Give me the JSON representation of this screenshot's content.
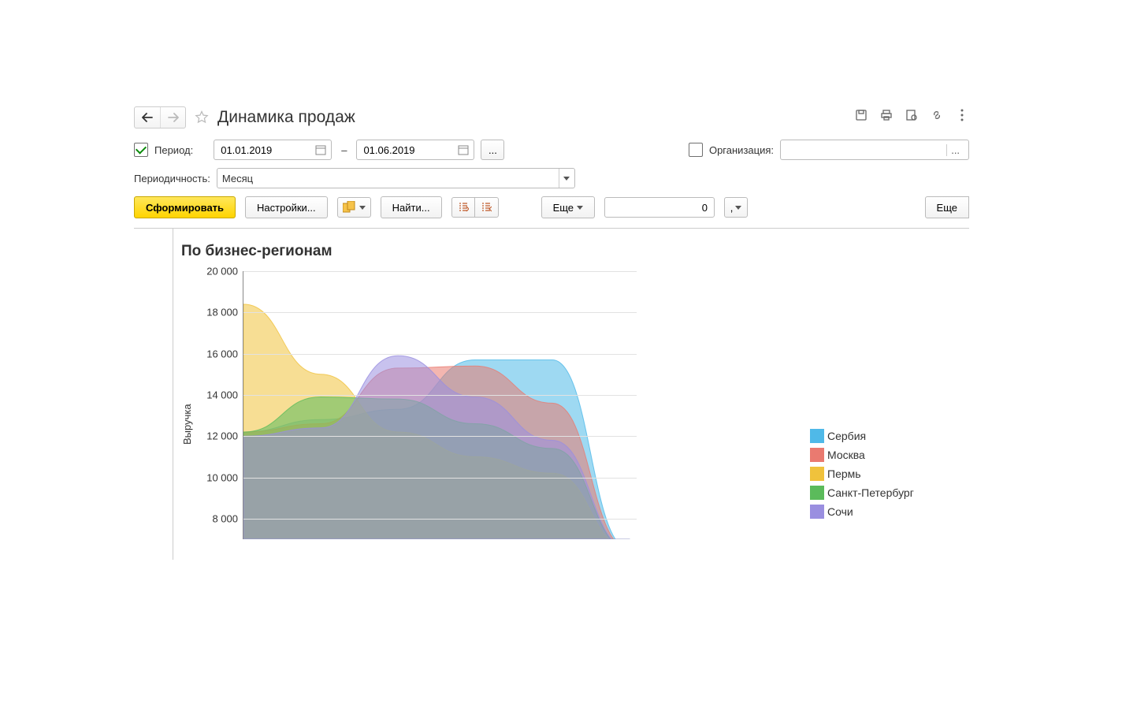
{
  "header": {
    "title": "Динамика продаж"
  },
  "period": {
    "label": "Период:",
    "from": "01.01.2019",
    "to": "01.06.2019",
    "dash": "–",
    "ellipsis": "...",
    "checked": true
  },
  "organization": {
    "label": "Организация:",
    "value": "",
    "ellipsis": "...",
    "checked": false
  },
  "periodicity": {
    "label": "Периодичность:",
    "value": "Месяц"
  },
  "toolbar": {
    "generate": "Сформировать",
    "settings": "Настройки...",
    "find": "Найти...",
    "more1": "Еще",
    "more2": "Еще",
    "num_value": "0",
    "decimal": ","
  },
  "chart": {
    "title": "По бизнес-регионам",
    "ylabel": "Выручка"
  },
  "legend": [
    {
      "name": "Сербия",
      "color": "#4fb9e8"
    },
    {
      "name": "Москва",
      "color": "#ea7a70"
    },
    {
      "name": "Пермь",
      "color": "#f0c23c"
    },
    {
      "name": "Санкт-Петербург",
      "color": "#5bbb5b"
    },
    {
      "name": "Сочи",
      "color": "#9a8fe0"
    }
  ],
  "chart_data": {
    "type": "area",
    "title": "По бизнес-регионам",
    "ylabel": "Выручка",
    "xlabel": "",
    "ylim": [
      7000,
      20000
    ],
    "yticks": [
      20000,
      18000,
      16000,
      14000,
      12000,
      10000,
      8000
    ],
    "ytick_labels": [
      "20 000",
      "18 000",
      "16 000",
      "14 000",
      "12 000",
      "10 000",
      "8 000"
    ],
    "x": [
      1,
      2,
      3,
      4,
      5,
      6
    ],
    "series": [
      {
        "name": "Сербия",
        "color": "#4fb9e8",
        "values": [
          12200,
          12800,
          13300,
          15700,
          15700,
          6500
        ]
      },
      {
        "name": "Москва",
        "color": "#ea7a70",
        "values": [
          12200,
          12600,
          15300,
          15400,
          13600,
          6500
        ]
      },
      {
        "name": "Пермь",
        "color": "#f0c23c",
        "values": [
          18400,
          15000,
          12200,
          11000,
          10200,
          6500
        ]
      },
      {
        "name": "Санкт-Петербург",
        "color": "#5bbb5b",
        "values": [
          12200,
          13900,
          13800,
          12600,
          11400,
          6500
        ]
      },
      {
        "name": "Сочи",
        "color": "#9a8fe0",
        "values": [
          12000,
          12400,
          15900,
          13900,
          11800,
          6500
        ]
      }
    ]
  }
}
